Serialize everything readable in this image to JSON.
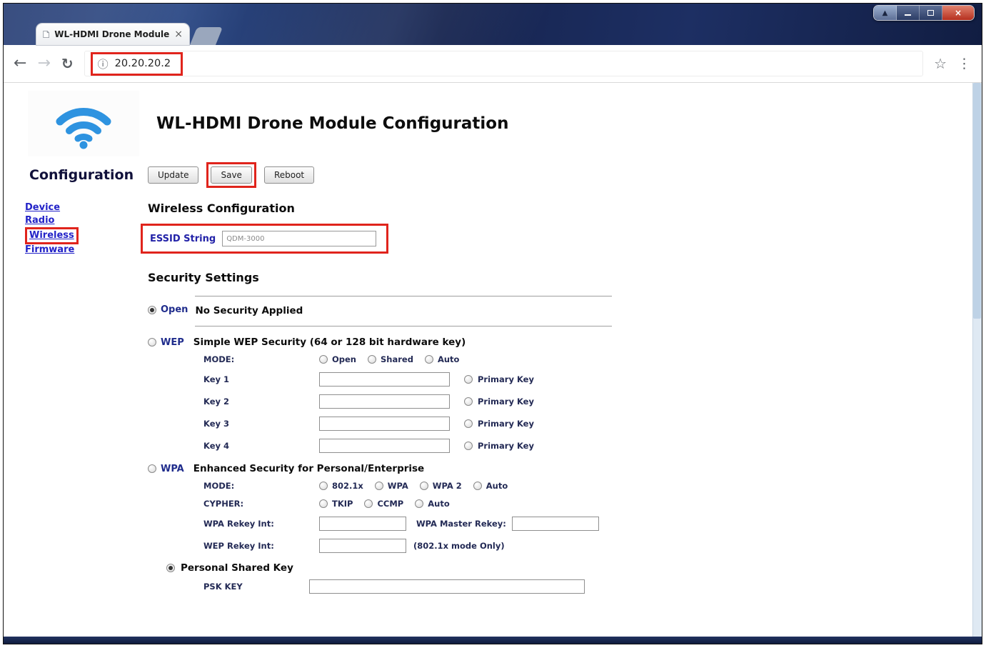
{
  "colors": {
    "annotation": "#e0241c",
    "link": "#2323c8",
    "label_navy": "#1f2c8c",
    "titlebar": "#1d2f63",
    "wifi_blue": "#2e93e0"
  },
  "window": {
    "controls": [
      {
        "name": "scroll-top",
        "glyph": "▲"
      },
      {
        "name": "minimize"
      },
      {
        "name": "maximize"
      },
      {
        "name": "close",
        "glyph": "×"
      }
    ]
  },
  "browser": {
    "tab": {
      "title": "WL-HDMI Drone Module",
      "close_glyph": "×"
    },
    "nav": {
      "back_glyph": "←",
      "forward_glyph": "→",
      "reload_glyph": "↻"
    },
    "info_glyph": "ⓘ",
    "url": "20.20.20.2",
    "bookmark_glyph": "☆",
    "menu_glyph": "⋮"
  },
  "page": {
    "title": "WL-HDMI Drone Module Configuration",
    "sidebar": {
      "heading": "Configuration",
      "links": [
        {
          "label": "Device"
        },
        {
          "label": "Radio"
        },
        {
          "label": "Wireless",
          "highlighted": true
        },
        {
          "label": "Firmware"
        }
      ]
    },
    "actions": {
      "update": "Update",
      "save": "Save",
      "reboot": "Reboot"
    },
    "wireless": {
      "heading": "Wireless Configuration",
      "essid_label": "ESSID String",
      "essid_value": "QDM-3000"
    },
    "security": {
      "heading": "Security Settings",
      "open": {
        "label": "Open",
        "selected": true,
        "desc": "No Security Applied"
      },
      "wep": {
        "label": "WEP",
        "selected": false,
        "desc": "Simple WEP Security (64 or 128 bit hardware key)",
        "mode_label": "MODE:",
        "mode_options": [
          {
            "label": "Open"
          },
          {
            "label": "Shared"
          },
          {
            "label": "Auto"
          }
        ],
        "keys": [
          {
            "label": "Key 1",
            "value": "",
            "primary_label": "Primary Key"
          },
          {
            "label": "Key 2",
            "value": "",
            "primary_label": "Primary Key"
          },
          {
            "label": "Key 3",
            "value": "",
            "primary_label": "Primary Key"
          },
          {
            "label": "Key 4",
            "value": "",
            "primary_label": "Primary Key"
          }
        ]
      },
      "wpa": {
        "label": "WPA",
        "selected": false,
        "desc": "Enhanced Security for Personal/Enterprise",
        "mode_label": "MODE:",
        "mode_options": [
          {
            "label": "802.1x"
          },
          {
            "label": "WPA"
          },
          {
            "label": "WPA 2"
          },
          {
            "label": "Auto"
          }
        ],
        "cypher_label": "CYPHER:",
        "cypher_options": [
          {
            "label": "TKIP"
          },
          {
            "label": "CCMP"
          },
          {
            "label": "Auto"
          }
        ],
        "wpa_rekey_label": "WPA Rekey Int:",
        "wpa_rekey_value": "",
        "master_rekey_label": "WPA Master Rekey:",
        "master_rekey_value": "",
        "wep_rekey_label": "WEP Rekey Int:",
        "wep_rekey_value": "",
        "wep_rekey_note": "(802.1x mode Only)"
      },
      "psk": {
        "label": "Personal Shared Key",
        "selected": true,
        "key_label": "PSK KEY",
        "key_value": ""
      }
    }
  }
}
